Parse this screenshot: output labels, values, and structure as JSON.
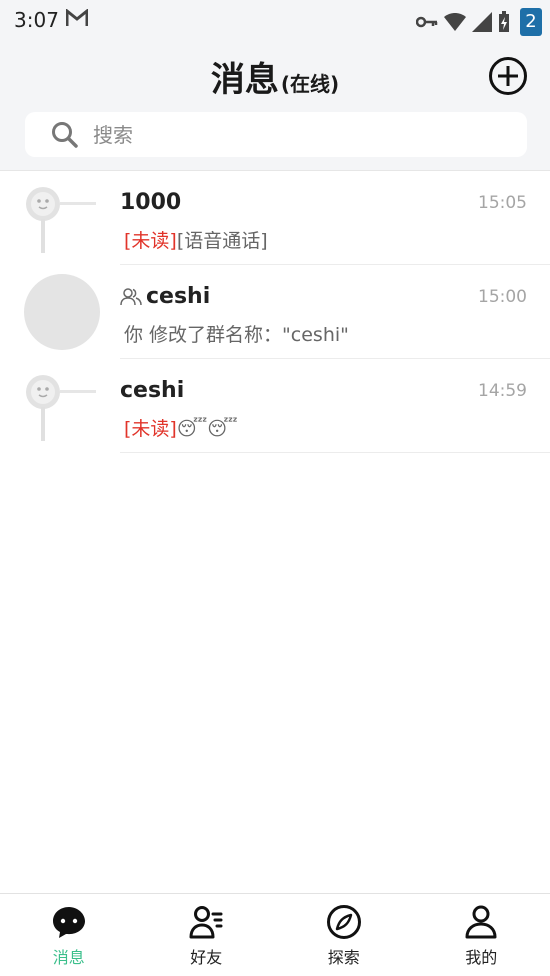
{
  "status_bar": {
    "time": "3:07",
    "notification_count": "2"
  },
  "header": {
    "title": "消息",
    "subtitle": "(在线)"
  },
  "search": {
    "placeholder": "搜索"
  },
  "conversations": [
    {
      "name": "1000",
      "time": "15:05",
      "unread_tag": "[未读]",
      "preview": "[语音通话]",
      "avatar": "robot-avatar",
      "is_group": false
    },
    {
      "name": "ceshi",
      "time": "15:00",
      "unread_tag": "",
      "preview": "你 修改了群名称：\"ceshi\"",
      "avatar": "blank-avatar",
      "is_group": true
    },
    {
      "name": "ceshi",
      "time": "14:59",
      "unread_tag": "[未读]",
      "preview": "😴😴",
      "avatar": "robot-avatar",
      "is_group": false
    }
  ],
  "bottom_nav": [
    {
      "label": "消息",
      "icon": "chat-bubble-icon",
      "active": true
    },
    {
      "label": "好友",
      "icon": "friends-icon",
      "active": false
    },
    {
      "label": "探索",
      "icon": "compass-icon",
      "active": false
    },
    {
      "label": "我的",
      "icon": "profile-icon",
      "active": false
    }
  ],
  "colors": {
    "accent": "#3bbf8b",
    "unread": "#e1342a",
    "header_bg": "#f4f5f7"
  }
}
